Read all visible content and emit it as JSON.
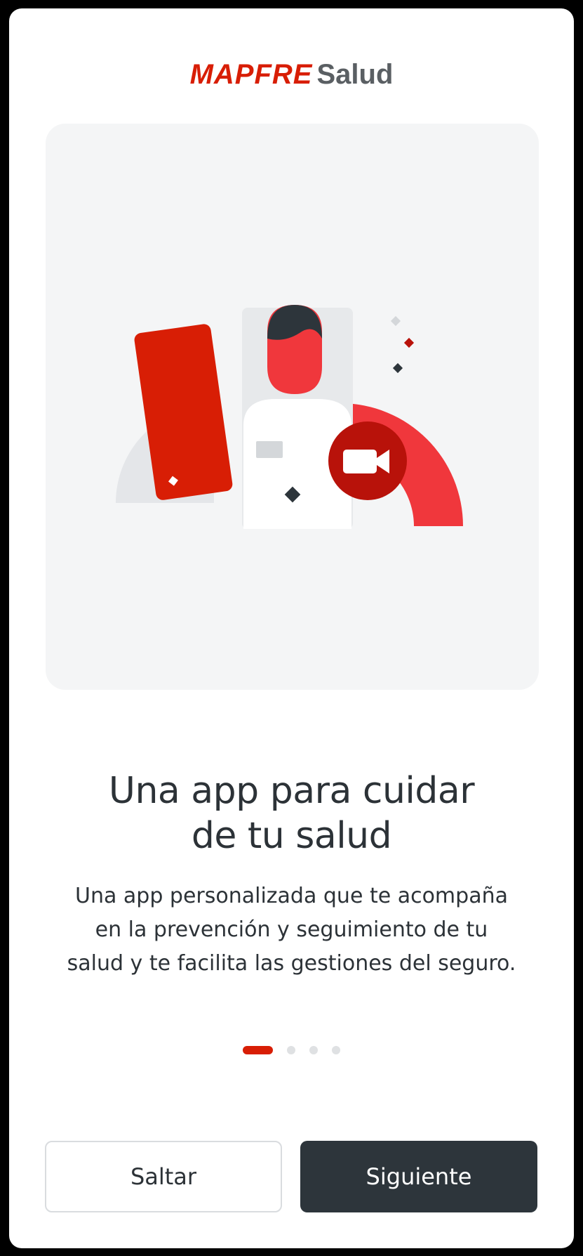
{
  "brand": {
    "name": "MAPFRE",
    "product": "Salud"
  },
  "onboarding": {
    "title_line1": "Una app para cuidar",
    "title_line2": "de tu salud",
    "description_line1": "Una app personalizada que te acompaña",
    "description_line2": "en la prevención y seguimiento de tu",
    "description_line3": "salud y te facilita las gestiones del seguro.",
    "illustration_icon": "video-call-icon",
    "pager": {
      "total": 4,
      "current": 1
    }
  },
  "actions": {
    "skip_label": "Saltar",
    "next_label": "Siguiente"
  },
  "colors": {
    "brand_red": "#d81e05",
    "accent_red": "#f0373c",
    "dark": "#2d353b",
    "card_bg": "#f4f5f6"
  }
}
